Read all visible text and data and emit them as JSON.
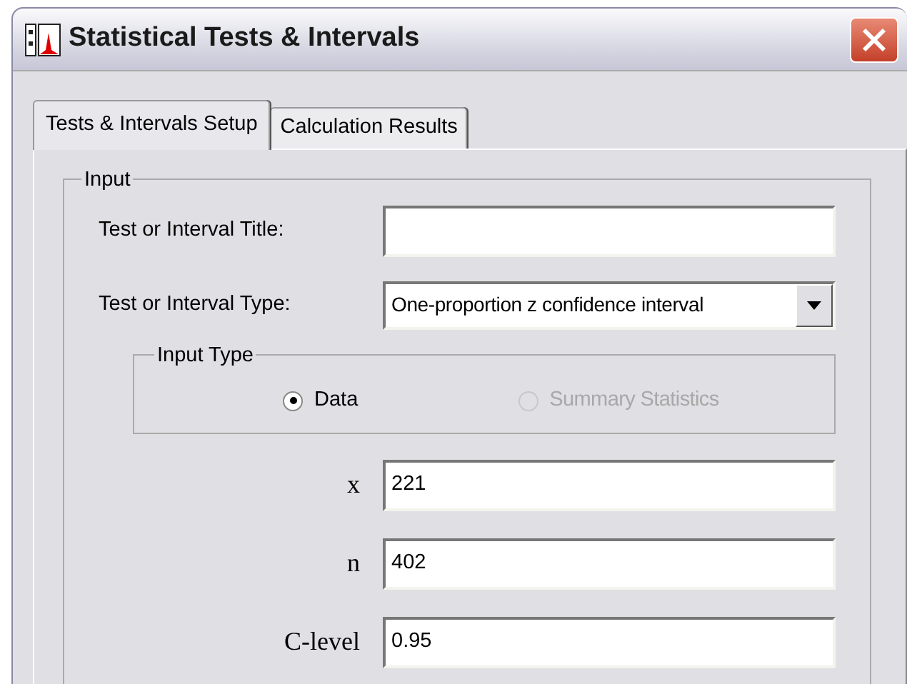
{
  "window": {
    "title": "Statistical Tests & Intervals"
  },
  "tabs": [
    {
      "label": "Tests & Intervals Setup",
      "selected": true
    },
    {
      "label": "Calculation Results",
      "selected": false
    }
  ],
  "input_group": {
    "legend": "Input",
    "title_field": {
      "label": "Test or Interval Title:"
    },
    "type_field": {
      "label": "Test or Interval Type:",
      "value": "One-proportion z confidence interval"
    },
    "input_type": {
      "legend": "Input Type",
      "options": [
        {
          "label": "Data",
          "selected": true,
          "disabled": false
        },
        {
          "label": "Summary Statistics",
          "selected": false,
          "disabled": true
        }
      ]
    },
    "params": [
      {
        "label": "x",
        "value": "221"
      },
      {
        "label": "n",
        "value": "402"
      },
      {
        "label": "C-level",
        "value": "0.95"
      }
    ]
  }
}
